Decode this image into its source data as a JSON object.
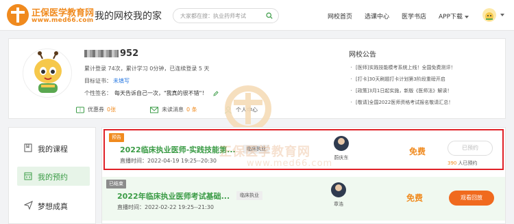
{
  "header": {
    "logo_cn": "正保医学教育网",
    "logo_url": "www.med66.com",
    "slogan": "我的网校我的家",
    "search_placeholder": "大家都在搜：执业药师考试",
    "nav": [
      "网校首页",
      "选课中心",
      "医学书店",
      "APP下载"
    ]
  },
  "profile": {
    "name_suffix": "952",
    "stats": "累计登录 74次，累计学习 0分钟，已连续登录 5 天",
    "target_label": "目标证书：",
    "target_value": "未填写",
    "sign_label": "个性签名：",
    "sign_text": "每天告诉自己一次，\"我真的很不错\"！",
    "coupon_label": "优惠券",
    "coupon_count": "0张",
    "message_label": "未读消息",
    "message_count": "0 条",
    "center_label": "个人中心"
  },
  "notice": {
    "title": "网校公告",
    "items": [
      "[医师]实践技能模考系统上线！全国免费测评！",
      "[打卡]30天刷题打卡计划第3阶段重磅开启",
      "[政策]3月1日起实施，新版《医师法》解读！",
      "[敬请]全国2022医师资格考试报名敬请汇总！"
    ]
  },
  "sidebar": {
    "items": [
      "我的课程",
      "我的预约",
      "梦想成真"
    ]
  },
  "courses": [
    {
      "status": "预告",
      "title": "2022临床执业医师-实践技能第...",
      "category": "临床执业",
      "time": "直播时间：2022-04-19 19:25--20:30",
      "teacher": "蔚庆东",
      "price": "免费",
      "action": "已预约",
      "reserved_num": "390",
      "reserved_suffix": "人已预约"
    },
    {
      "status": "已结束",
      "title": "2022年临床执业医师考试基础...",
      "category": "临床执业",
      "time": "直播时间：2022-02-22 19:25--21:30",
      "teacher": "章浩",
      "price": "免费",
      "action": "观看回放"
    }
  ],
  "watermark": {
    "text": "正保医学教育网",
    "url": "www.med66.com"
  },
  "colors": {
    "brand_orange": "#f08a1e",
    "accent_green": "#3a9b45",
    "highlight_red": "#e01f26"
  }
}
